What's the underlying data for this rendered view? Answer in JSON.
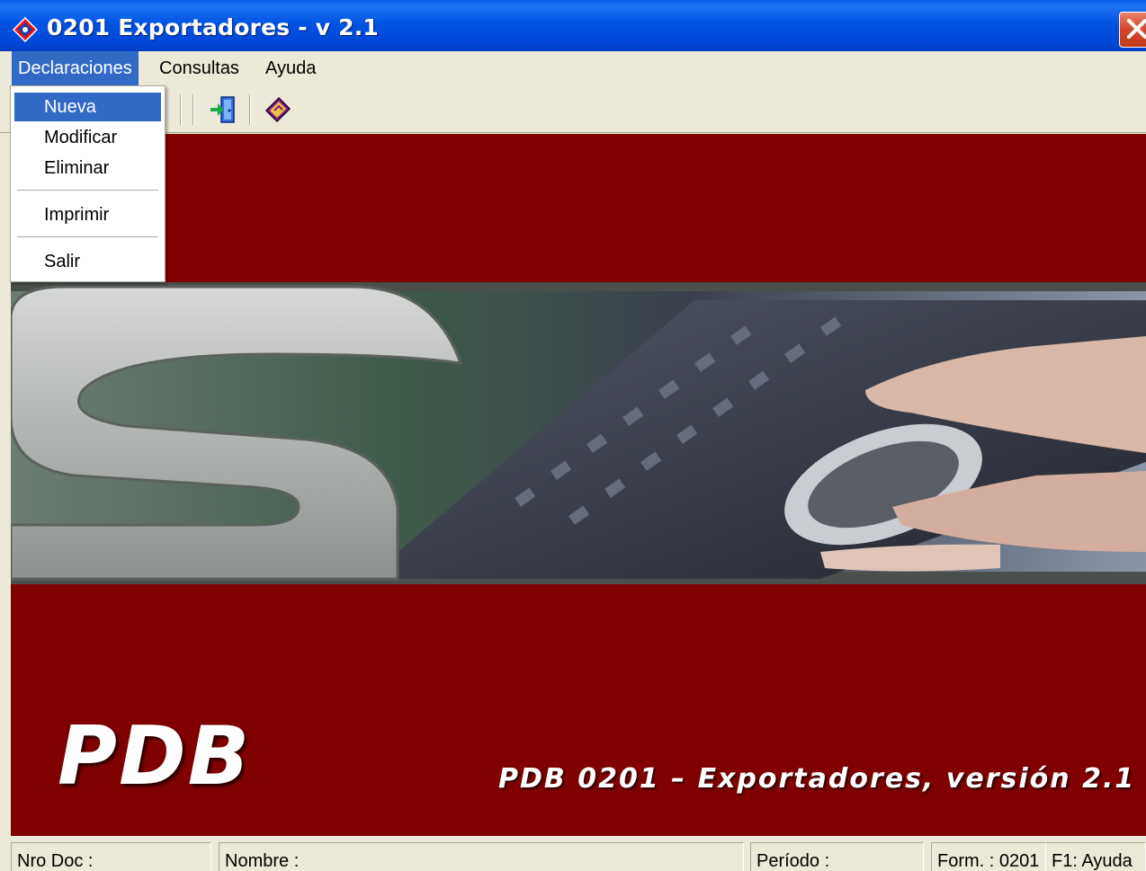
{
  "window": {
    "title": "0201 Exportadores - v 2.1"
  },
  "menubar": {
    "items": [
      {
        "label": "Declaraciones",
        "active": true
      },
      {
        "label": "Consultas",
        "active": false
      },
      {
        "label": "Ayuda",
        "active": false
      }
    ]
  },
  "dropdown": {
    "items": [
      {
        "label": "Nueva",
        "highlighted": true
      },
      {
        "label": "Modificar"
      },
      {
        "label": "Eliminar"
      },
      {
        "label": "Imprimir"
      },
      {
        "label": "Salir"
      }
    ]
  },
  "toolbar": {
    "buttons": [
      {
        "icon": "exit-door-icon"
      },
      {
        "icon": "help-book-icon"
      }
    ]
  },
  "splash": {
    "logo": "PDB",
    "tagline": "PDB 0201 – Exportadores, versión 2.1"
  },
  "statusbar": {
    "doc": "Nro Doc :",
    "nombre": "Nombre :",
    "periodo": "Período :",
    "form": "Form. : 0201",
    "help": "F1: Ayuda"
  },
  "colors": {
    "titlebar": "#0054e3",
    "background": "#800000",
    "menu_highlight": "#316ac5",
    "chrome": "#ece9d8"
  }
}
